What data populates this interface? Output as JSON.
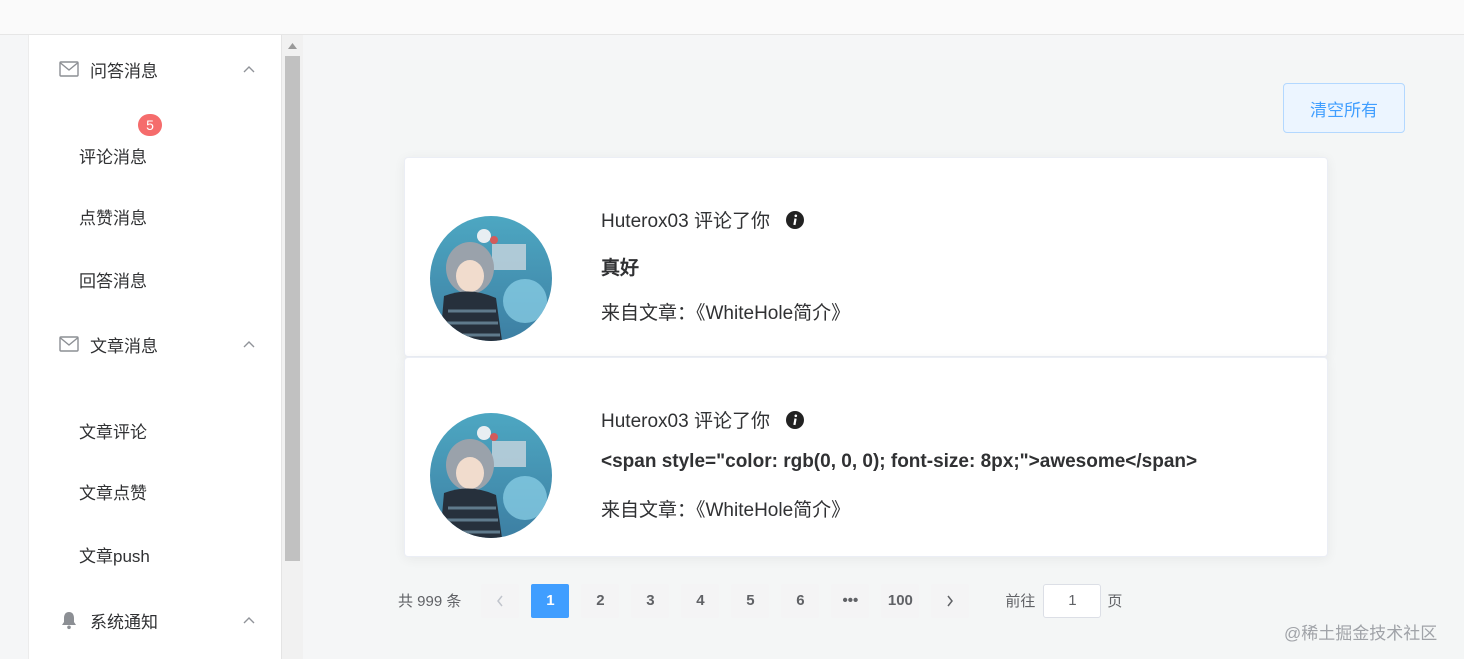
{
  "sidebar": {
    "groups": [
      {
        "label": "问答消息",
        "icon": "mail-icon"
      },
      {
        "label": "文章消息",
        "icon": "mail-icon"
      },
      {
        "label": "系统通知",
        "icon": "bell-icon"
      }
    ],
    "qa_items": [
      {
        "label": "评论消息",
        "badge": "5"
      },
      {
        "label": "点赞消息"
      },
      {
        "label": "回答消息"
      }
    ],
    "article_items": [
      {
        "label": "文章评论"
      },
      {
        "label": "文章点赞"
      },
      {
        "label": "文章push"
      }
    ]
  },
  "toolbar": {
    "clear_label": "清空所有"
  },
  "messages": [
    {
      "header": "Huterox03 评论了你",
      "content": "真好",
      "source": "来自文章：《WhiteHole简介》"
    },
    {
      "header": "Huterox03 评论了你",
      "content": "<span style=\"color: rgb(0, 0, 0); font-size: 8px;\">awesome</span>",
      "source": "来自文章：《WhiteHole简介》"
    }
  ],
  "pagination": {
    "total_text": "共 999 条",
    "pages": [
      "1",
      "2",
      "3",
      "4",
      "5",
      "6",
      "•••",
      "100"
    ],
    "current": "1",
    "goto_label": "前往",
    "goto_value": "1",
    "page_suffix": "页"
  },
  "watermark": "@稀土掘金技术社区",
  "colors": {
    "accent": "#409eff",
    "badge": "#f56c6c",
    "clear_button_bg": "#ecf5ff"
  }
}
